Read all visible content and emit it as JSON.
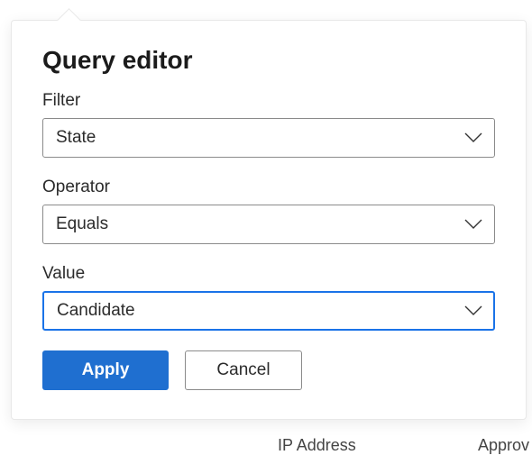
{
  "panel": {
    "title": "Query editor",
    "filter": {
      "label": "Filter",
      "value": "State"
    },
    "operator": {
      "label": "Operator",
      "value": "Equals"
    },
    "value": {
      "label": "Value",
      "value": "Candidate"
    },
    "buttons": {
      "apply": "Apply",
      "cancel": "Cancel"
    }
  },
  "background": {
    "ip_label": "IP Address",
    "approv_label": "Approv"
  },
  "colors": {
    "primary": "#1f6fd0",
    "focus": "#1a73e8",
    "border": "#8a8a8a"
  }
}
